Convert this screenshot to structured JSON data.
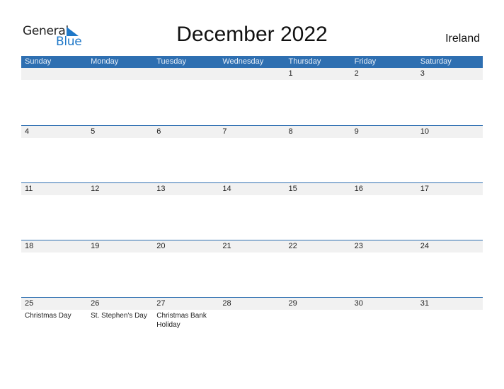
{
  "logo": {
    "line1": "General",
    "line2": "Blue",
    "accent": "#1f78c8"
  },
  "title": "December 2022",
  "country": "Ireland",
  "colors": {
    "header_bg": "#2e6fb1",
    "day_bar_bg": "#f1f1f1"
  },
  "weekdays": [
    "Sunday",
    "Monday",
    "Tuesday",
    "Wednesday",
    "Thursday",
    "Friday",
    "Saturday"
  ],
  "weeks": [
    {
      "days": [
        "",
        "",
        "",
        "",
        "1",
        "2",
        "3"
      ],
      "events": [
        "",
        "",
        "",
        "",
        "",
        "",
        ""
      ]
    },
    {
      "days": [
        "4",
        "5",
        "6",
        "7",
        "8",
        "9",
        "10"
      ],
      "events": [
        "",
        "",
        "",
        "",
        "",
        "",
        ""
      ]
    },
    {
      "days": [
        "11",
        "12",
        "13",
        "14",
        "15",
        "16",
        "17"
      ],
      "events": [
        "",
        "",
        "",
        "",
        "",
        "",
        ""
      ]
    },
    {
      "days": [
        "18",
        "19",
        "20",
        "21",
        "22",
        "23",
        "24"
      ],
      "events": [
        "",
        "",
        "",
        "",
        "",
        "",
        ""
      ]
    },
    {
      "days": [
        "25",
        "26",
        "27",
        "28",
        "29",
        "30",
        "31"
      ],
      "events": [
        "Christmas Day",
        "St. Stephen's Day",
        "Christmas Bank Holiday",
        "",
        "",
        "",
        ""
      ]
    }
  ]
}
